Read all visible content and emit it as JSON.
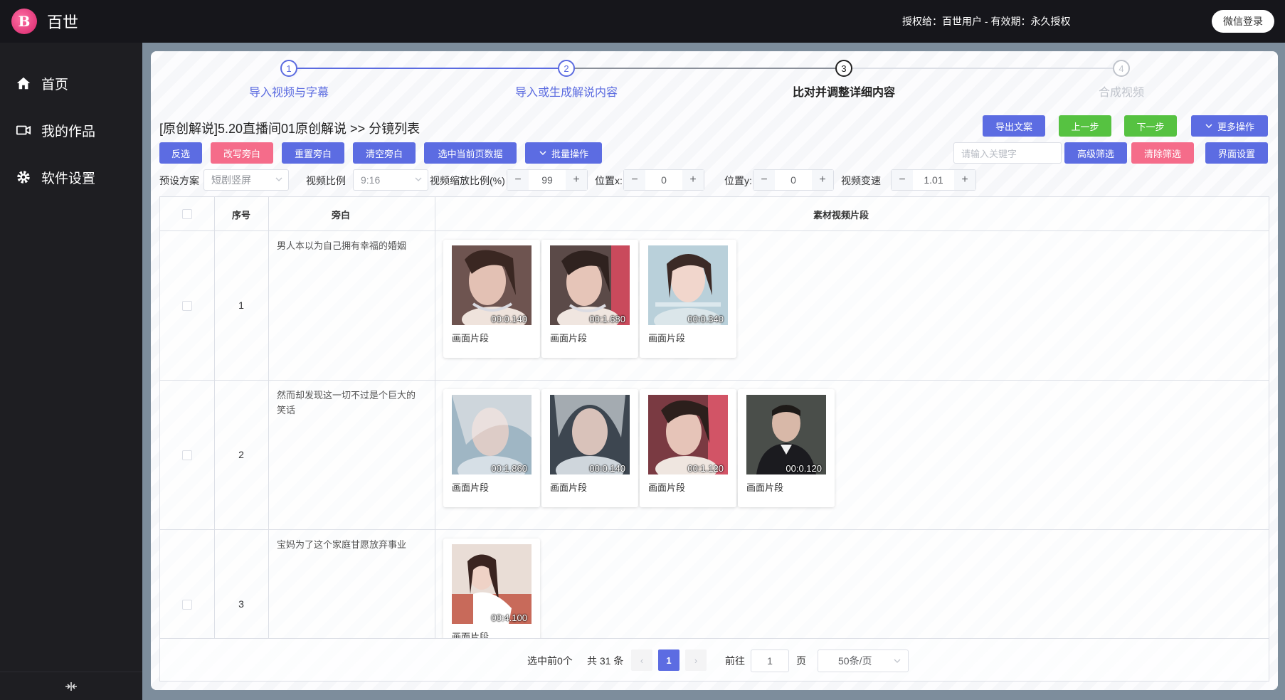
{
  "app": {
    "logo_letter": "B",
    "name": "百世"
  },
  "header": {
    "license": "授权给：百世用户 - 有效期：永久授权",
    "wechat_login": "微信登录"
  },
  "sidebar": {
    "items": [
      {
        "label": "首页",
        "icon": "home-icon"
      },
      {
        "label": "我的作品",
        "icon": "video-camera-icon"
      },
      {
        "label": "软件设置",
        "icon": "gear-icon"
      }
    ],
    "collapse_icon": "collapse-icon"
  },
  "steps": [
    {
      "num": "1",
      "label": "导入视频与字幕",
      "state": "done"
    },
    {
      "num": "2",
      "label": "导入或生成解说内容",
      "state": "done"
    },
    {
      "num": "3",
      "label": "比对并调整详细内容",
      "state": "active"
    },
    {
      "num": "4",
      "label": "合成视频",
      "state": "todo"
    }
  ],
  "breadcrumb": "[原创解说]5.20直播间01原创解说 >> 分镜列表",
  "actions": {
    "export": "导出文案",
    "prev": "上一步",
    "next": "下一步",
    "more": "更多操作",
    "invert": "反选",
    "rewrite": "改写旁白",
    "reset": "重置旁白",
    "clear": "清空旁白",
    "select_page": "选中当前页数据",
    "batch": "批量操作",
    "keyword_placeholder": "请输入关键字",
    "advanced_filter": "高级筛选",
    "clear_filter": "清除筛选",
    "ui_settings": "界面设置"
  },
  "settings": {
    "preset_label": "预设方案",
    "preset_value": "短剧竖屏",
    "ratio_label": "视频比例",
    "ratio_value": "9:16",
    "scale_label": "视频缩放比例(%)",
    "scale_value": "99",
    "posx_label": "位置x:",
    "posx_value": "0",
    "posy_label": "位置y:",
    "posy_value": "0",
    "speed_label": "视频变速",
    "speed_value": "1.01",
    "minus": "−",
    "plus": "+"
  },
  "table": {
    "headers": {
      "seq": "序号",
      "narration": "旁白",
      "clips": "素材视频片段"
    },
    "rows": [
      {
        "seq": "1",
        "narration": "男人本以为自己拥有幸福的婚姻",
        "clips": [
          {
            "dur": "00:0.140",
            "label": "画面片段"
          },
          {
            "dur": "00:1.680",
            "label": "画面片段"
          },
          {
            "dur": "00:0.340",
            "label": "画面片段"
          }
        ]
      },
      {
        "seq": "2",
        "narration": "然而却发现这一切不过是个巨大的笑话",
        "clips": [
          {
            "dur": "00:1.860",
            "label": "画面片段"
          },
          {
            "dur": "00:0.140",
            "label": "画面片段"
          },
          {
            "dur": "00:1.120",
            "label": "画面片段"
          },
          {
            "dur": "00:0.120",
            "label": "画面片段"
          }
        ]
      },
      {
        "seq": "3",
        "narration": "宝妈为了这个家庭甘愿放弃事业",
        "clips": [
          {
            "dur": "00:4.100",
            "label": "画面片段"
          }
        ]
      }
    ]
  },
  "pagination": {
    "selected": "选中前0个",
    "total": "共 31 条",
    "current_page": "1",
    "goto_label": "前往",
    "goto_value": "1",
    "page_unit": "页",
    "page_size": "50条/页",
    "prev_icon": "‹",
    "next_icon": "›"
  }
}
